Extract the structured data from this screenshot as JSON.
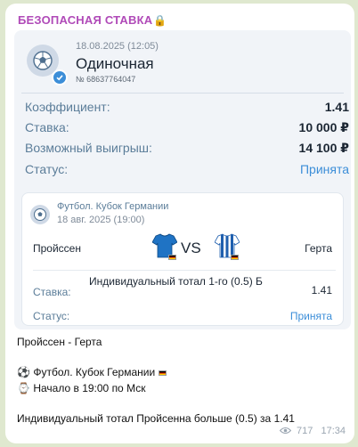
{
  "post": {
    "channel_title": "БЕЗОПАСНАЯ СТАВКА",
    "lock_icon": "🔒",
    "views": "717",
    "time": "17:34"
  },
  "ticket": {
    "date": "18.08.2025 (12:05)",
    "type": "Одиночная",
    "number": "№ 68637764047",
    "rows": [
      {
        "label": "Коэффициент:",
        "value": "1.41"
      },
      {
        "label": "Ставка:",
        "value": "10 000 ₽"
      },
      {
        "label": "Возможный выигрыш:",
        "value": "14 100 ₽"
      },
      {
        "label": "Статус:",
        "value": "Принята"
      }
    ]
  },
  "event": {
    "league": "Футбол. Кубок Германии",
    "date": "18 авг. 2025 (19:00)",
    "home_team": "Пройссен",
    "away_team": "Герта",
    "vs": "VS",
    "bet_label": "Ставка:",
    "bet_desc": "Индивидуальный тотал 1-го (0.5) Б",
    "bet_odd": "1.41",
    "status_label": "Статус:",
    "status_value": "Принята"
  },
  "message": {
    "teams": "Пройссен - Герта",
    "soccer_icon": "⚽",
    "league": "Футбол. Кубок Германии",
    "watch_icon": "⌚",
    "start": "Начало в 19:00 по Мск",
    "pick": "Индивидуальный тотал Пройсенна больше (0.5) за 1.41"
  },
  "colors": {
    "channel": "#b04ab8",
    "accent": "#3c8ed8",
    "label": "#5b7d99",
    "background": "#dfe8cf"
  }
}
